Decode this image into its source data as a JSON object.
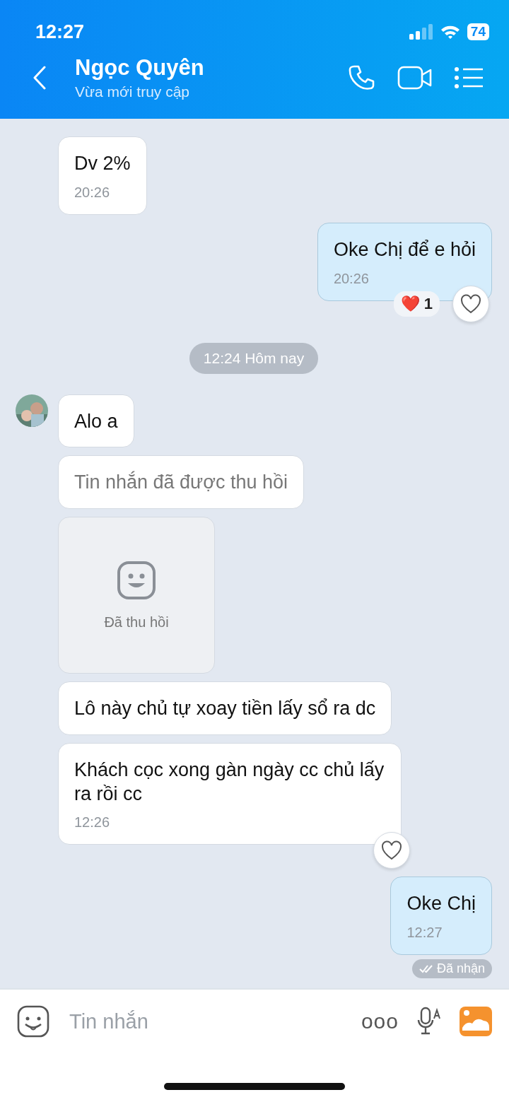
{
  "status_bar": {
    "time": "12:27",
    "battery": "74"
  },
  "header": {
    "title": "Ngọc Quyên",
    "subtitle": "Vừa mới truy cập"
  },
  "messages": [
    {
      "kind": "text",
      "outgoing": false,
      "text": "Dv 2%",
      "time": "20:26"
    },
    {
      "kind": "text",
      "outgoing": true,
      "text": "Oke Chị để e hỏi",
      "time": "20:26",
      "reaction": {
        "emoji": "❤️",
        "count": "1"
      },
      "like_button": true
    },
    {
      "kind": "separator",
      "text": "12:24 Hôm nay"
    },
    {
      "kind": "text",
      "outgoing": false,
      "avatar": true,
      "text": "Alo a"
    },
    {
      "kind": "recalled_text",
      "outgoing": false,
      "text": "Tin nhắn đã được thu hồi"
    },
    {
      "kind": "recalled_media",
      "outgoing": false,
      "text": "Đã thu hồi"
    },
    {
      "kind": "text",
      "outgoing": false,
      "text": "Lô này chủ tự xoay tiền lấy sổ ra dc"
    },
    {
      "kind": "text",
      "outgoing": false,
      "text": "Khách cọc xong gàn ngày cc chủ lấy ra rồi cc",
      "time": "12:26",
      "like_button": true
    },
    {
      "kind": "text",
      "outgoing": true,
      "text": "Oke Chị",
      "time": "12:27",
      "status": "Đã nhận"
    }
  ],
  "composer": {
    "placeholder": "Tin nhắn",
    "more": "ooo"
  }
}
